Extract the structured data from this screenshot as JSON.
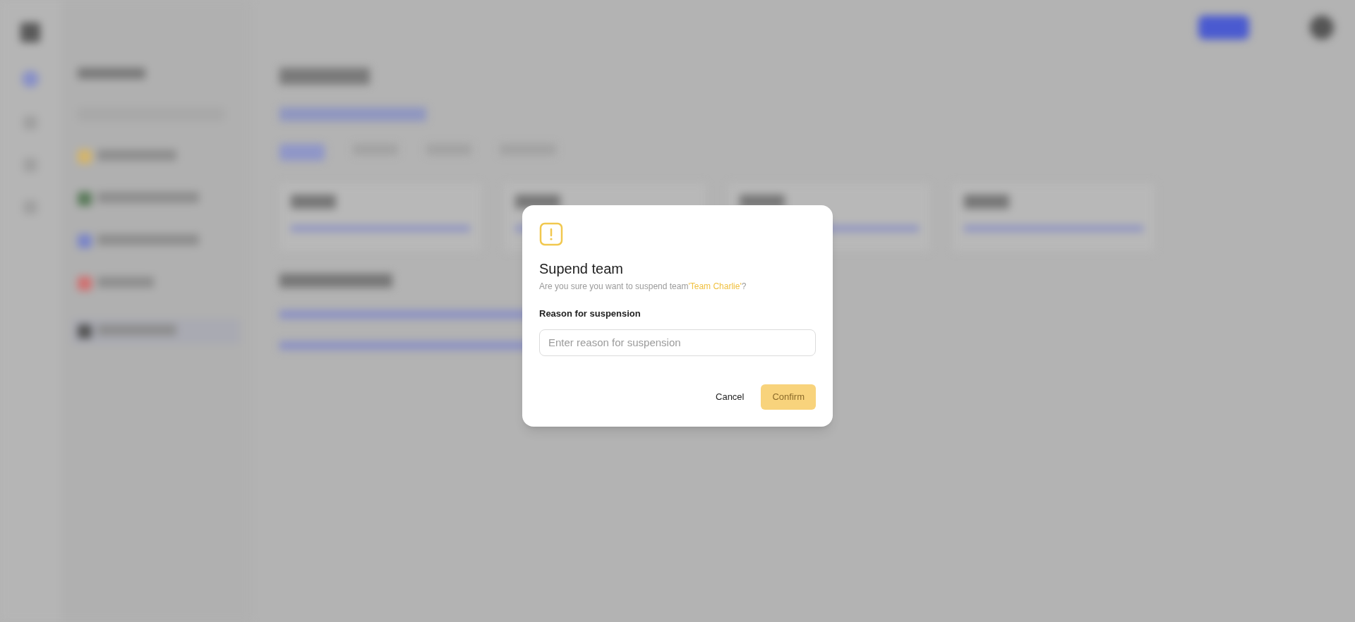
{
  "dialog": {
    "title": "Supend team",
    "message": {
      "text": "Are you sure you want to suspend team",
      "highlight": "'Team Charlie'",
      "end": "?"
    },
    "field": {
      "label": "Reason for suspension",
      "placeholder": "Enter reason for suspension"
    },
    "buttons": [
      {
        "label": "Cancel",
        "kind": "secondary",
        "disabled": false
      },
      {
        "label": "Confirm",
        "kind": "primary",
        "disabled": true
      }
    ]
  }
}
